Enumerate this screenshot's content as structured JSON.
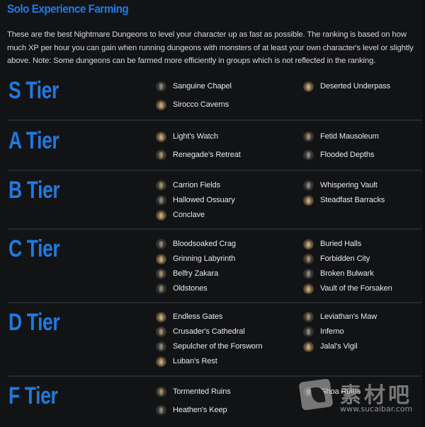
{
  "title": "Solo Experience Farming",
  "intro": "These are the best Nightmare Dungeons to level your character up as fast as possible. The ranking is based on how much XP per hour you can gain when running dungeons with monsters of at least your own character's level or slightly above. Note: Some dungeons can be farmed more efficiently in groups which is not reflected in the ranking.",
  "tiers": [
    {
      "label": "S Tier",
      "left": [
        "Sanguine Chapel",
        "Sirocco Caverns"
      ],
      "right": [
        "Deserted Underpass"
      ]
    },
    {
      "label": "A Tier",
      "left": [
        "Light's Watch",
        "Renegade's Retreat"
      ],
      "right": [
        "Fetid Mausoleum",
        "Flooded Depths"
      ]
    },
    {
      "label": "B Tier",
      "left": [
        "Carrion Fields",
        "Hallowed Ossuary",
        "Conclave"
      ],
      "right": [
        "Whispering Vault",
        "Steadfast Barracks"
      ]
    },
    {
      "label": "C Tier",
      "left": [
        "Bloodsoaked Crag",
        "Grinning Labyrinth",
        "Belfry Zakara",
        "Oldstones"
      ],
      "right": [
        "Buried Halls",
        "Forbidden City",
        "Broken Bulwark",
        "Vault of the Forsaken"
      ]
    },
    {
      "label": "D Tier",
      "left": [
        "Endless Gates",
        "Crusader's Cathedral",
        "Sepulcher of the Forsworn",
        "Luban's Rest"
      ],
      "right": [
        "Leviathan's Maw",
        "Inferno",
        "Jalal's Vigil"
      ]
    },
    {
      "label": "F Tier",
      "left": [
        "Tormented Ruins",
        "Heathen's Keep"
      ],
      "right": [
        "Ghoa Ruins"
      ]
    }
  ],
  "icon_name": "dungeon-region-icon",
  "watermark": {
    "cn": "素材吧",
    "url": "www.sucaibar.com"
  },
  "colors": {
    "accent": "#1f7ae0",
    "background": "#121315",
    "separator": "#26282b"
  }
}
